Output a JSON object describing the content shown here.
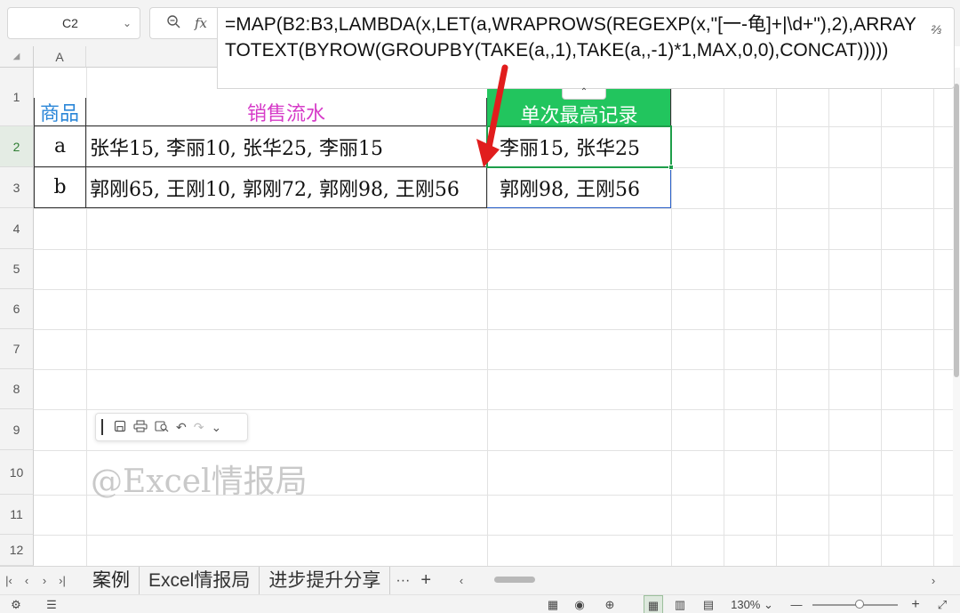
{
  "formula_bar": {
    "name_box": "C2",
    "fx": "fx",
    "formula": "=MAP(B2:B3,LAMBDA(x,LET(a,WRAPROWS(REGEXP(x,\"[一-龟]+|\\d+\"),2),ARRAYTOTEXT(BYROW(GROUPBY(TAKE(a,,1),TAKE(a,,-1)*1,MAX,0,0),CONCAT)))))",
    "collapse_glyph": "⌃"
  },
  "columns": [
    "A"
  ],
  "rows": [
    "1",
    "2",
    "3",
    "4",
    "5",
    "6",
    "7",
    "8",
    "9",
    "10",
    "11",
    "12"
  ],
  "table": {
    "header": {
      "product": "商品",
      "sales": "销售流水",
      "record": "单次最高记录"
    },
    "rows": [
      {
        "product": "a",
        "sales": "张华15, 李丽10, 张华25, 李丽15",
        "record": "李丽15,  张华25"
      },
      {
        "product": "b",
        "sales": "郭刚65, 王刚10, 郭刚72, 郭刚98, 王刚56",
        "record": "郭刚98,  王刚56"
      }
    ]
  },
  "colors": {
    "product_header": "#2a86d8",
    "sales_header": "#d63bc8",
    "record_header_bg": "#22c55e",
    "record_header_fg": "#ffffff",
    "arrow": "#e11d1d",
    "selection": "#1e9e4a"
  },
  "watermark": "@Excel情报局",
  "mini_toolbar": [
    "save-icon",
    "print-icon",
    "print-preview-icon",
    "undo-icon",
    "redo-icon",
    "chevron-down-icon"
  ],
  "sheet_tabs": [
    "案例",
    "Excel情报局",
    "进步提升分享"
  ],
  "tab_more": "···",
  "tab_add": "+",
  "status": {
    "zoom": "130%",
    "zoom_minus": "—",
    "zoom_plus": "+"
  }
}
